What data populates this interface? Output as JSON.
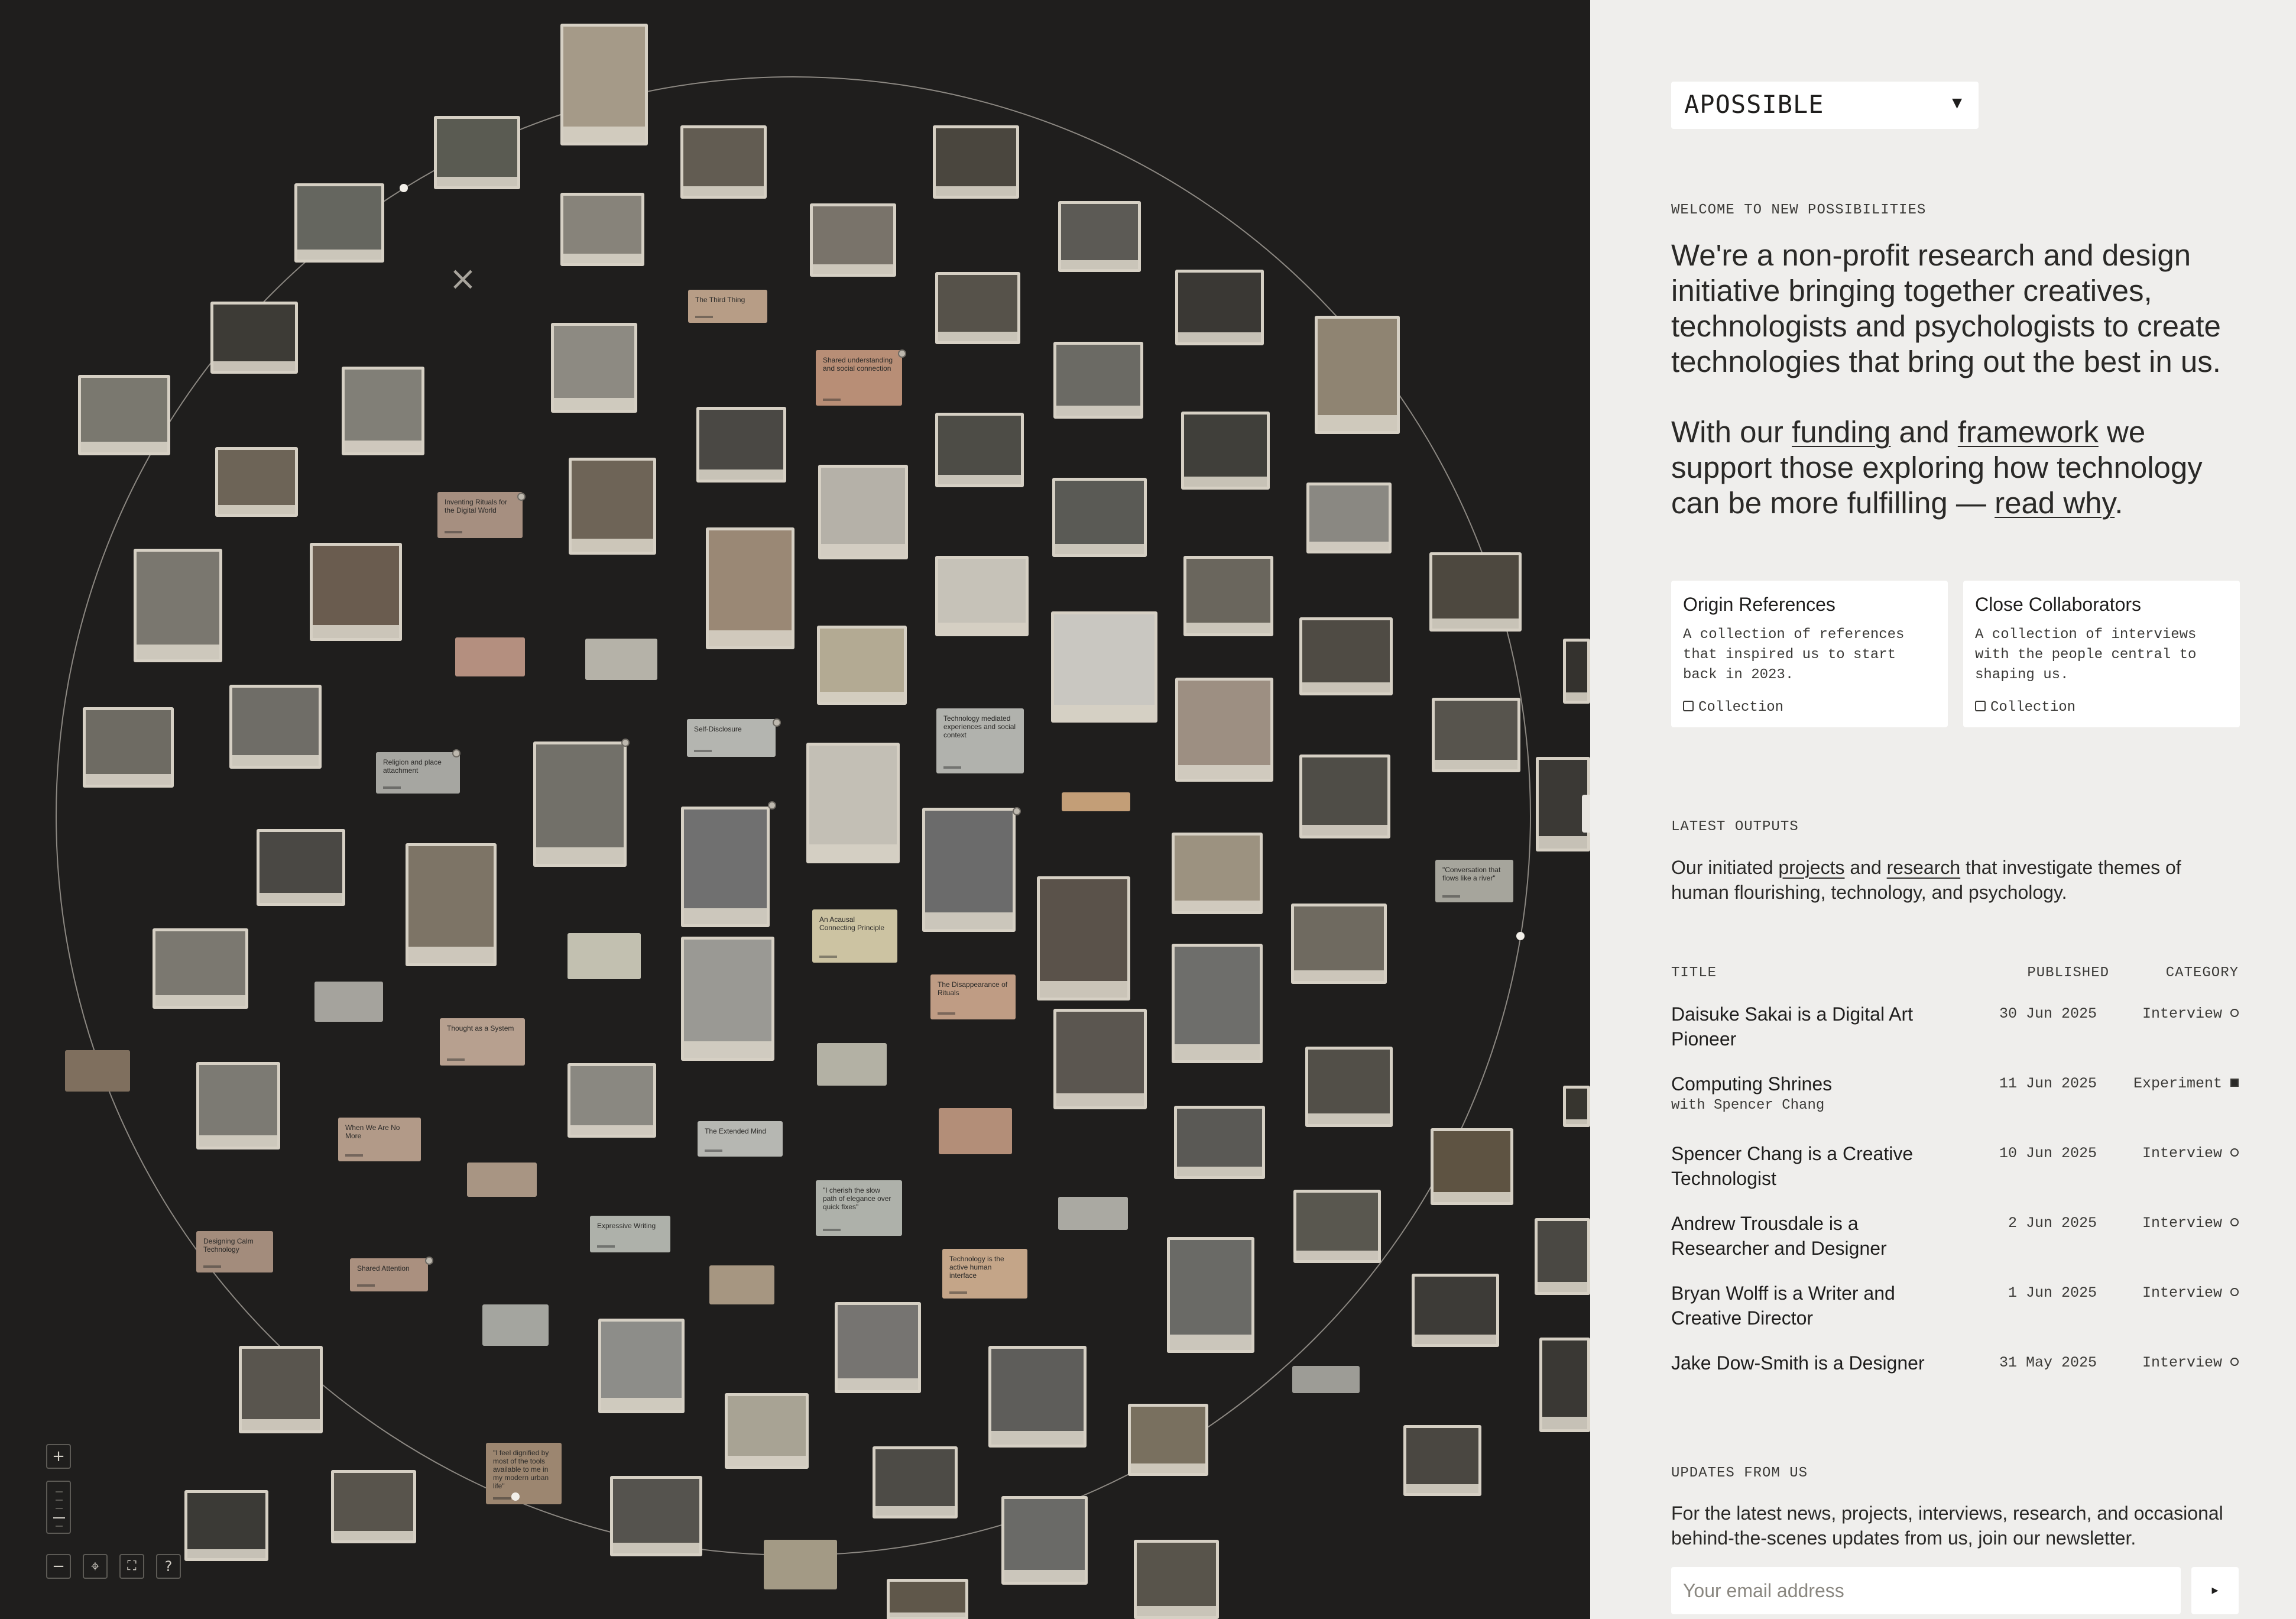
{
  "canvas": {
    "close_label": "×",
    "zoom_in": "+",
    "zoom_out": "−",
    "recenter": "⌖",
    "fullscreen": "⛶",
    "help": "?",
    "notes": [
      "The Third Thing",
      "Shared understanding and social connection",
      "Inventing Rituals for the Digital World",
      "Self-Disclosure",
      "Technology mediated experiences and social context",
      "Religion and place attachment",
      "An Acausal Connecting Principle",
      "The Disappearance of Rituals",
      "Thought as a System",
      "When We Are No More",
      "The Extended Mind",
      "\"I cherish the slow path of elegance over quick fixes\"",
      "Expressive Writing",
      "Technology is the active human interface",
      "Designing Calm Technology",
      "Shared Attention",
      "\"I feel dignified by most of the tools available to me in my modern urban life\"",
      "\"Conversation that flows like a river\""
    ]
  },
  "panel": {
    "logo": "APOSSIBLE",
    "welcome_eyebrow": "WELCOME TO NEW POSSIBILITIES",
    "intro": "We're a non-profit research and design initiative bringing together creatives, technologists and psychologists to create technologies that bring out the best in us.",
    "support": {
      "p1": "With our ",
      "funding": "funding",
      "p2": " and ",
      "framework": "framework",
      "p3": " we support those exploring how technology can be more fulfilling — ",
      "read_why": "read why",
      "p4": "."
    },
    "collections": [
      {
        "title": "Origin References",
        "desc": "A collection of references that inspired us to start back in 2023.",
        "tag": "Collection"
      },
      {
        "title": "Close Collaborators",
        "desc": "A collection of interviews with the people central to shaping us.",
        "tag": "Collection"
      }
    ],
    "latest_eyebrow": "LATEST OUTPUTS",
    "latest": {
      "p1": "Our initiated ",
      "projects": "projects",
      "p2": " and ",
      "research": "research",
      "p3": " that investigate themes of human flourishing, technology, and psychology."
    },
    "table": {
      "headers": {
        "title": "TITLE",
        "published": "PUBLISHED",
        "category": "CATEGORY"
      },
      "rows": [
        {
          "title": "Daisuke Sakai is a Digital Art Pioneer",
          "sub": "",
          "date": "30 Jun 2025",
          "category": "Interview",
          "icon": "circle-icon"
        },
        {
          "title": "Computing Shrines",
          "sub": "with Spencer Chang",
          "date": "11 Jun 2025",
          "category": "Experiment",
          "icon": "square-icon"
        },
        {
          "title": "Spencer Chang is a Creative Technologist",
          "sub": "",
          "date": "10 Jun 2025",
          "category": "Interview",
          "icon": "circle-icon"
        },
        {
          "title": "Andrew Trousdale is a Researcher and Designer",
          "sub": "",
          "date": "2 Jun 2025",
          "category": "Interview",
          "icon": "circle-icon"
        },
        {
          "title": "Bryan Wolff is a Writer and Creative Director",
          "sub": "",
          "date": "1 Jun 2025",
          "category": "Interview",
          "icon": "circle-icon"
        },
        {
          "title": "Jake Dow-Smith is a Designer",
          "sub": "",
          "date": "31 May 2025",
          "category": "Interview",
          "icon": "circle-icon"
        }
      ]
    },
    "updates_eyebrow": "UPDATES FROM US",
    "updates_text": "For the latest news, projects, interviews, research, and occasional behind-the-scenes updates from us, join our newsletter.",
    "email_placeholder": "Your email address",
    "submit_label": "▸"
  },
  "colors": {
    "canvas_bg": "#1f1e1d",
    "panel_bg": "#efeeec",
    "text": "#2a2927"
  }
}
